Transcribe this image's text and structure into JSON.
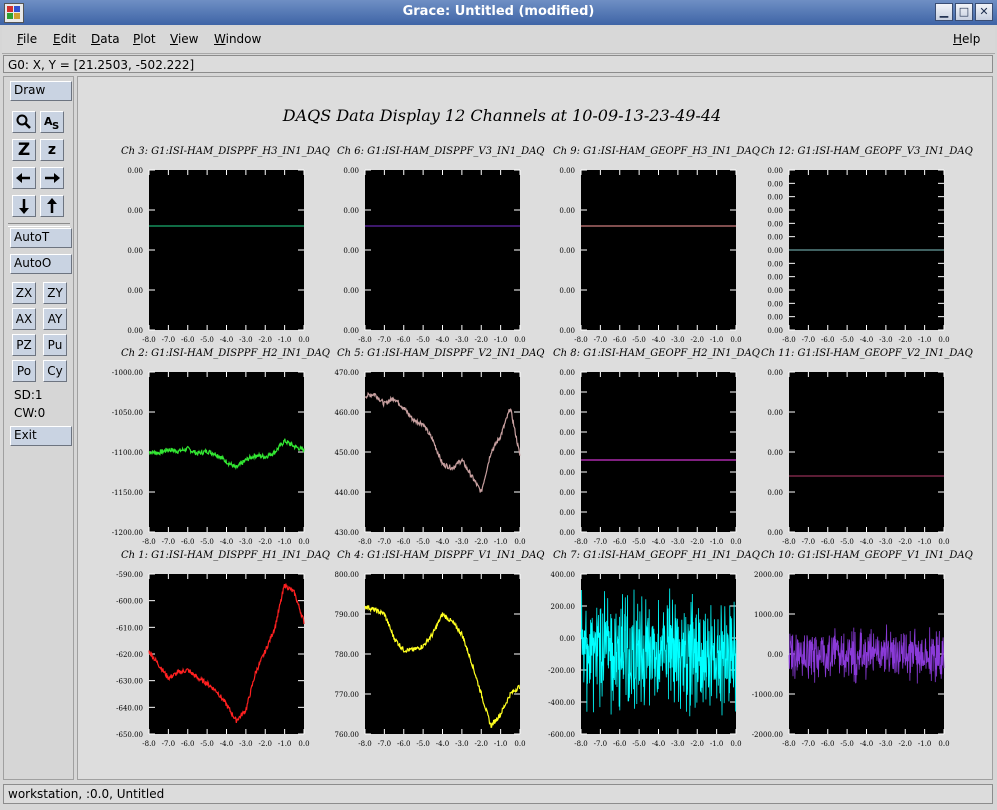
{
  "window": {
    "title": "Grace: Untitled (modified)",
    "minimize_label": "▁",
    "maximize_label": "□",
    "close_label": "✕"
  },
  "menu": {
    "file_first": "F",
    "file_rest": "ile",
    "edit_first": "E",
    "edit_rest": "dit",
    "data_first": "D",
    "data_rest": "ata",
    "plot_first": "P",
    "plot_rest": "lot",
    "view_first": "V",
    "view_rest": "iew",
    "window_first": "W",
    "window_rest": "indow",
    "help_first": "H",
    "help_rest": "elp"
  },
  "locator": "G0: X, Y = [21.2503, -502.222]",
  "toolbar": {
    "draw": "Draw",
    "zoom_big": "Z",
    "zoom_small": "z",
    "autot": "AutoT",
    "autoo": "AutoO",
    "zx": "ZX",
    "zy": "ZY",
    "ax": "AX",
    "ay": "AY",
    "pz": "PZ",
    "pu": "Pu",
    "po": "Po",
    "cy": "Cy",
    "sd": "SD:1",
    "cw": "CW:0",
    "exit": "Exit"
  },
  "status": "workstation, :0.0, Untitled",
  "chart_data": {
    "title": "DAQS Data Display 12 Channels at 10-09-13-23-49-44",
    "type": "line",
    "x_ticks": [
      "-8.0",
      "-7.0",
      "-6.0",
      "-5.0",
      "-4.0",
      "-3.0",
      "-2.0",
      "-1.0",
      "0.0"
    ],
    "xlim": [
      -8,
      0
    ],
    "background": "#000000",
    "panels": [
      {
        "label": "Ch 3:  G1:ISI-HAM_DISPPF_H3_IN1_DAQ",
        "y_ticks": [
          "0.00",
          "0.00",
          "0.00",
          "0.00",
          "0.00"
        ],
        "color": "#21d88a",
        "kind": "flat",
        "level": 0.35
      },
      {
        "label": "Ch 6:  G1:ISI-HAM_DISPPF_V3_IN1_DAQ",
        "y_ticks": [
          "0.00",
          "0.00",
          "0.00",
          "0.00",
          "0.00"
        ],
        "color": "#7a2fd6",
        "kind": "flat",
        "level": 0.35
      },
      {
        "label": "Ch 9:  G1:ISI-HAM_GEOPF_H3_IN1_DAQ",
        "y_ticks": [
          "0.00",
          "0.00",
          "0.00",
          "0.00",
          "0.00"
        ],
        "color": "#ff9b9b",
        "kind": "flat",
        "level": 0.35
      },
      {
        "label": "Ch 12:  G1:ISI-HAM_GEOPF_V3_IN1_DAQ",
        "y_ticks": [
          "0.00",
          "0.00",
          "0.00",
          "0.00",
          "0.00",
          "0.00",
          "0.00",
          "0.00",
          "0.00",
          "0.00",
          "0.00",
          "0.00",
          "0.00"
        ],
        "color": "#7fc3c3",
        "kind": "flat",
        "level": 0.5
      },
      {
        "label": "Ch 2:  G1:ISI-HAM_DISPPF_H2_IN1_DAQ",
        "y_ticks": [
          "-1000.00",
          "-1050.00",
          "-1100.00",
          "-1150.00",
          "-1200.00"
        ],
        "ylim": [
          -1200,
          -1000
        ],
        "color": "#32e632",
        "kind": "trace",
        "points": [
          [
            -8,
            -1100
          ],
          [
            -7.5,
            -1101
          ],
          [
            -7,
            -1097
          ],
          [
            -6.5,
            -1099
          ],
          [
            -6,
            -1096
          ],
          [
            -5.5,
            -1102
          ],
          [
            -5,
            -1099
          ],
          [
            -4.5,
            -1103
          ],
          [
            -4,
            -1112
          ],
          [
            -3.5,
            -1120
          ],
          [
            -3,
            -1110
          ],
          [
            -2.5,
            -1104
          ],
          [
            -2,
            -1106
          ],
          [
            -1.5,
            -1100
          ],
          [
            -1,
            -1086
          ],
          [
            -0.5,
            -1093
          ],
          [
            0,
            -1098
          ]
        ]
      },
      {
        "label": "Ch 5:  G1:ISI-HAM_DISPPF_V2_IN1_DAQ",
        "y_ticks": [
          "470.00",
          "460.00",
          "450.00",
          "440.00",
          "430.00"
        ],
        "ylim": [
          430,
          470
        ],
        "color": "#c8a0a0",
        "kind": "trace",
        "points": [
          [
            -8,
            464
          ],
          [
            -7.5,
            464.5
          ],
          [
            -7,
            462
          ],
          [
            -6.5,
            463.5
          ],
          [
            -6,
            461
          ],
          [
            -5.5,
            458
          ],
          [
            -5,
            457
          ],
          [
            -4.5,
            453
          ],
          [
            -4,
            447
          ],
          [
            -3.5,
            446
          ],
          [
            -3,
            448
          ],
          [
            -2.5,
            444
          ],
          [
            -2,
            440
          ],
          [
            -1.5,
            450
          ],
          [
            -1,
            454
          ],
          [
            -0.5,
            461
          ],
          [
            0,
            449
          ]
        ]
      },
      {
        "label": "Ch 8:  G1:ISI-HAM_GEOPF_H2_IN1_DAQ",
        "y_ticks": [
          "0.00",
          "0.00",
          "0.00",
          "0.00",
          "0.00",
          "0.00",
          "0.00",
          "0.00",
          "0.00"
        ],
        "color": "#ff40ff",
        "kind": "flat",
        "level": 0.55
      },
      {
        "label": "Ch 11:  G1:ISI-HAM_GEOPF_V2_IN1_DAQ",
        "y_ticks": [
          "0.00",
          "0.00",
          "0.00",
          "0.00",
          "0.00"
        ],
        "color": "#b83a6a",
        "kind": "flat",
        "level": 0.65
      },
      {
        "label": "Ch 1:  G1:ISI-HAM_DISPPF_H1_IN1_DAQ",
        "y_ticks": [
          "-590.00",
          "-600.00",
          "-610.00",
          "-620.00",
          "-630.00",
          "-640.00",
          "-650.00"
        ],
        "ylim": [
          -650,
          -590
        ],
        "color": "#ff2020",
        "kind": "trace",
        "points": [
          [
            -8,
            -619
          ],
          [
            -7.5,
            -624
          ],
          [
            -7,
            -629
          ],
          [
            -6.5,
            -627
          ],
          [
            -6,
            -626
          ],
          [
            -5.5,
            -629
          ],
          [
            -5,
            -631
          ],
          [
            -4.5,
            -634
          ],
          [
            -4,
            -639
          ],
          [
            -3.5,
            -645
          ],
          [
            -3,
            -641
          ],
          [
            -2.5,
            -627
          ],
          [
            -2,
            -619
          ],
          [
            -1.5,
            -610
          ],
          [
            -1,
            -594
          ],
          [
            -0.5,
            -597
          ],
          [
            0,
            -608
          ]
        ]
      },
      {
        "label": "Ch 4:  G1:ISI-HAM_DISPPF_V1_IN1_DAQ",
        "y_ticks": [
          "800.00",
          "790.00",
          "780.00",
          "770.00",
          "760.00"
        ],
        "ylim": [
          760,
          800
        ],
        "color": "#ffff20",
        "kind": "trace",
        "points": [
          [
            -8,
            792
          ],
          [
            -7.5,
            791
          ],
          [
            -7,
            790
          ],
          [
            -6.5,
            784
          ],
          [
            -6,
            781
          ],
          [
            -5.5,
            781
          ],
          [
            -5,
            782
          ],
          [
            -4.5,
            785
          ],
          [
            -4,
            790
          ],
          [
            -3.5,
            788
          ],
          [
            -3,
            785
          ],
          [
            -2.5,
            778
          ],
          [
            -2,
            770
          ],
          [
            -1.5,
            762
          ],
          [
            -1,
            765
          ],
          [
            -0.5,
            770
          ],
          [
            0,
            772
          ]
        ]
      },
      {
        "label": "Ch 7:  G1:ISI-HAM_GEOPF_H1_IN1_DAQ",
        "y_ticks": [
          "400.00",
          "200.00",
          "0.00",
          "-200.00",
          "-400.00",
          "-600.00"
        ],
        "ylim": [
          -700,
          500
        ],
        "color": "#00ffff",
        "kind": "noise",
        "amp": 0.42,
        "center": 0.5
      },
      {
        "label": "Ch 10:  G1:ISI-HAM_GEOPF_V1_IN1_DAQ",
        "y_ticks": [
          "2000.00",
          "1000.00",
          "0.00",
          "-1000.00",
          "-2000.00"
        ],
        "ylim": [
          -2000,
          2000
        ],
        "color": "#8a3ad8",
        "kind": "noise",
        "amp": 0.2,
        "center": 0.5
      }
    ]
  }
}
